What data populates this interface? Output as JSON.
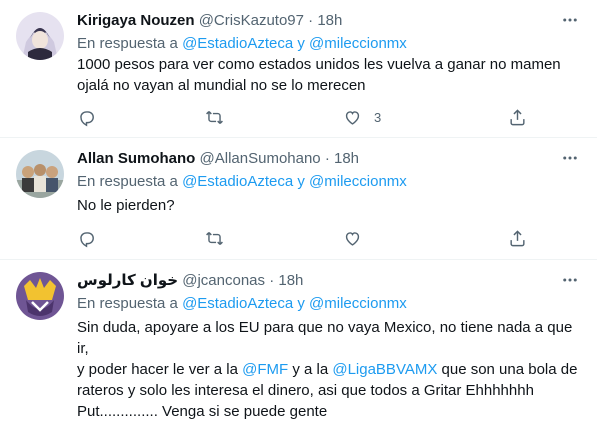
{
  "tweets": [
    {
      "name": "Kirigaya Nouzen",
      "handle": "@CrisKazuto97",
      "dot": "·",
      "time": "18h",
      "reply_prefix": "En respuesta a",
      "reply_mention1": "@EstadioAzteca",
      "reply_and": "y",
      "reply_mention2": "@mileccionmx",
      "text": "1000 pesos para ver como estados unidos les vuelva a ganar no mamen\nojalá no vayan al mundial no se lo merecen",
      "like_count": "3",
      "avatar_colors": [
        "#d8d4e8",
        "#3a3550",
        "#c9c2db"
      ]
    },
    {
      "name": "Allan Sumohano",
      "handle": "@AllanSumohano",
      "dot": "·",
      "time": "18h",
      "reply_prefix": "En respuesta a",
      "reply_mention1": "@EstadioAzteca",
      "reply_and": "y",
      "reply_mention2": "@mileccionmx",
      "text": "No le pierden?",
      "avatar_colors": [
        "#b9c9d4",
        "#c9a27a",
        "#3b3b3b"
      ]
    },
    {
      "name": "خوان كارلوس",
      "handle": "@jcanconas",
      "dot": "·",
      "time": "18h",
      "reply_prefix": "En respuesta a",
      "reply_mention1": "@EstadioAzteca",
      "reply_and": "y",
      "reply_mention2": "@mileccionmx",
      "text_part1": "Sin duda, apoyare a los EU para que no vaya Mexico, no tiene nada a que ir,\ny poder hacer le ver a la ",
      "text_mention1": "@FMF",
      "text_part2": " y a la ",
      "text_mention2": "@LigaBBVAMX",
      "text_part3": " que son una bola de\nrateros y solo les interesa el dinero, asi que todos a Gritar Ehhhhhhh\nPut.............. Venga si se puede gente",
      "avatar_colors": [
        "#7b5fa0",
        "#f2c230",
        "#5a3e7e"
      ]
    }
  ]
}
